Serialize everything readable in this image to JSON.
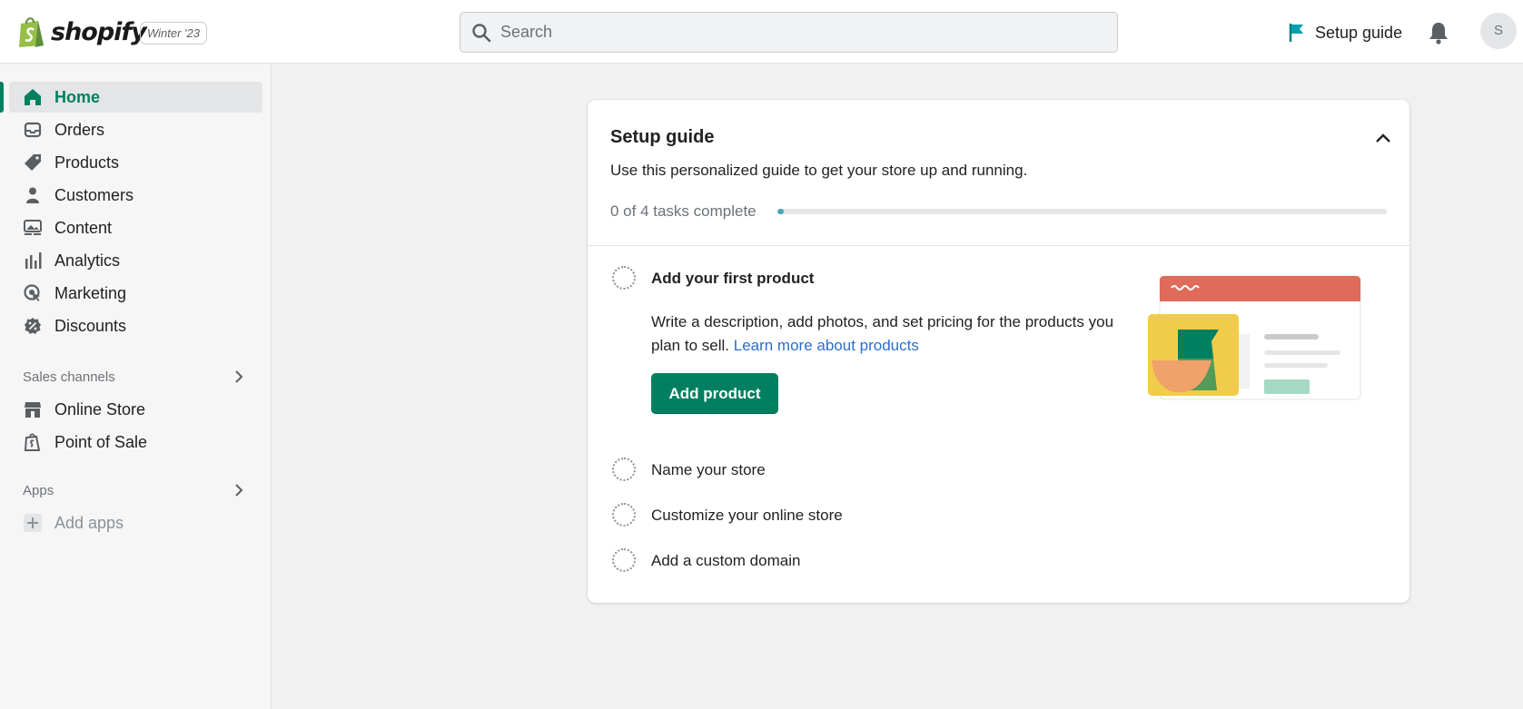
{
  "header": {
    "brand": "shopify",
    "edition": "Winter '23",
    "search_placeholder": "Search",
    "setup_guide_label": "Setup guide",
    "avatar_initial": "S"
  },
  "sidebar": {
    "items": [
      {
        "label": "Home",
        "icon": "home-icon",
        "active": true
      },
      {
        "label": "Orders",
        "icon": "inbox-icon"
      },
      {
        "label": "Products",
        "icon": "tag-icon"
      },
      {
        "label": "Customers",
        "icon": "person-icon"
      },
      {
        "label": "Content",
        "icon": "image-icon"
      },
      {
        "label": "Analytics",
        "icon": "bar-chart-icon"
      },
      {
        "label": "Marketing",
        "icon": "target-icon"
      },
      {
        "label": "Discounts",
        "icon": "discount-icon"
      }
    ],
    "sales_channels": {
      "heading": "Sales channels",
      "items": [
        {
          "label": "Online Store",
          "icon": "store-icon"
        },
        {
          "label": "Point of Sale",
          "icon": "pos-bag-icon"
        }
      ]
    },
    "apps": {
      "heading": "Apps",
      "add_label": "Add apps"
    }
  },
  "setup_guide": {
    "title": "Setup guide",
    "subtitle": "Use this personalized guide to get your store up and running.",
    "progress_text": "0 of 4 tasks complete",
    "progress_fraction": 0.01,
    "tasks": [
      {
        "title": "Add your first product",
        "expanded": true,
        "description": "Write a description, add photos, and set pricing for the products you plan to sell.",
        "link_text": "Learn more about products",
        "button_label": "Add product"
      },
      {
        "title": "Name your store"
      },
      {
        "title": "Customize your online store"
      },
      {
        "title": "Add a custom domain"
      }
    ]
  },
  "colors": {
    "brand_green": "#008060",
    "progress_teal": "#47a7b8",
    "link_blue": "#2c6ecb",
    "illustration_red": "#e06b5b",
    "illustration_yellow": "#f1cc4a"
  }
}
